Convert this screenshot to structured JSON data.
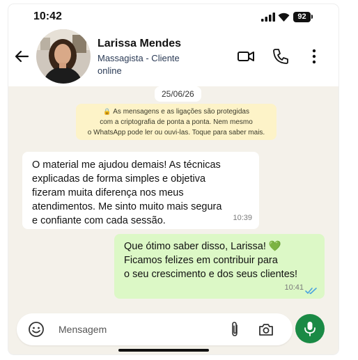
{
  "status_bar": {
    "time": "10:42",
    "battery": "92"
  },
  "header": {
    "contact_name": "Larissa Mendes",
    "subtitle": "Massagista - Cliente",
    "presence": "online",
    "icons": [
      "back-arrow-icon",
      "video-call-icon",
      "voice-call-icon",
      "more-vert-icon"
    ]
  },
  "chat": {
    "date_chip": "25/06/26",
    "encryption_notice": {
      "lines": [
        "As mensagens e as ligações são protegidas",
        "com a criptografia de ponta a ponta. Nem mesmo",
        "o WhatsApp pode ler ou ouvi-las. Toque para saber mais."
      ]
    },
    "messages": [
      {
        "direction": "incoming",
        "lines": [
          "O material me ajudou demais! As técnicas",
          "explicadas de forma simples e objetiva",
          "fizeram muita diferença nos meus",
          "atendimentos. Me sinto muito mais segura",
          "e confiante com cada sessão."
        ],
        "time": "10:39"
      },
      {
        "direction": "outgoing",
        "lines": [
          "Que ótimo saber disso, Larissa! 💚",
          "Ficamos felizes em contribuir para",
          "o seu crescimento e dos seus clientes!"
        ],
        "time": "10:41",
        "read": true
      }
    ]
  },
  "composer": {
    "placeholder": "Mensagem"
  },
  "colors": {
    "chat_bg": "#f4f1ea",
    "outgoing_bubble": "#dcf8c6",
    "notice_bg": "#fdf3c8",
    "mic_button": "#1a8a45",
    "read_ticks": "#4aa3df"
  }
}
